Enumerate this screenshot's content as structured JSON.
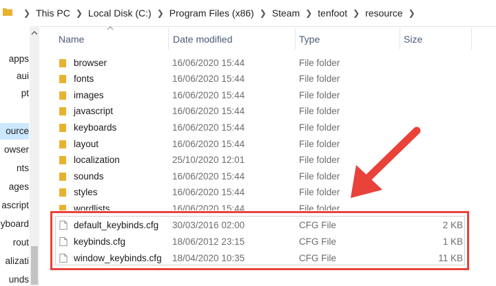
{
  "breadcrumbs": [
    "This PC",
    "Local Disk (C:)",
    "Program Files (x86)",
    "Steam",
    "tenfoot",
    "resource"
  ],
  "nav_items": [
    "apps",
    "aui",
    "pt",
    "ource",
    "owser",
    "nts",
    "ages",
    "ascript",
    "yboard",
    "rout",
    "alizati",
    "unds"
  ],
  "columns": {
    "name": "Name",
    "date": "Date modified",
    "type": "Type",
    "size": "Size"
  },
  "folders": [
    {
      "name": "browser",
      "date": "16/06/2020 15:44",
      "type": "File folder"
    },
    {
      "name": "fonts",
      "date": "16/06/2020 15:44",
      "type": "File folder"
    },
    {
      "name": "images",
      "date": "16/06/2020 15:44",
      "type": "File folder"
    },
    {
      "name": "javascript",
      "date": "16/06/2020 15:44",
      "type": "File folder"
    },
    {
      "name": "keyboards",
      "date": "16/06/2020 15:44",
      "type": "File folder"
    },
    {
      "name": "layout",
      "date": "16/06/2020 15:44",
      "type": "File folder"
    },
    {
      "name": "localization",
      "date": "25/10/2020 12:01",
      "type": "File folder"
    },
    {
      "name": "sounds",
      "date": "16/06/2020 15:44",
      "type": "File folder"
    },
    {
      "name": "styles",
      "date": "16/06/2020 15:44",
      "type": "File folder"
    },
    {
      "name": "wordlists",
      "date": "16/06/2020 15:44",
      "type": "File folder"
    }
  ],
  "files": [
    {
      "name": "default_keybinds.cfg",
      "date": "30/03/2016 02:00",
      "type": "CFG File",
      "size": "2 KB"
    },
    {
      "name": "keybinds.cfg",
      "date": "18/06/2012 23:15",
      "type": "CFG File",
      "size": "1 KB"
    },
    {
      "name": "window_keybinds.cfg",
      "date": "18/04/2020 10:35",
      "type": "CFG File",
      "size": "11 KB"
    }
  ],
  "colors": {
    "folder": "#e8b230",
    "selection": "#cce8ff",
    "highlight": "#e8423a",
    "header_text": "#4a5b7a"
  }
}
